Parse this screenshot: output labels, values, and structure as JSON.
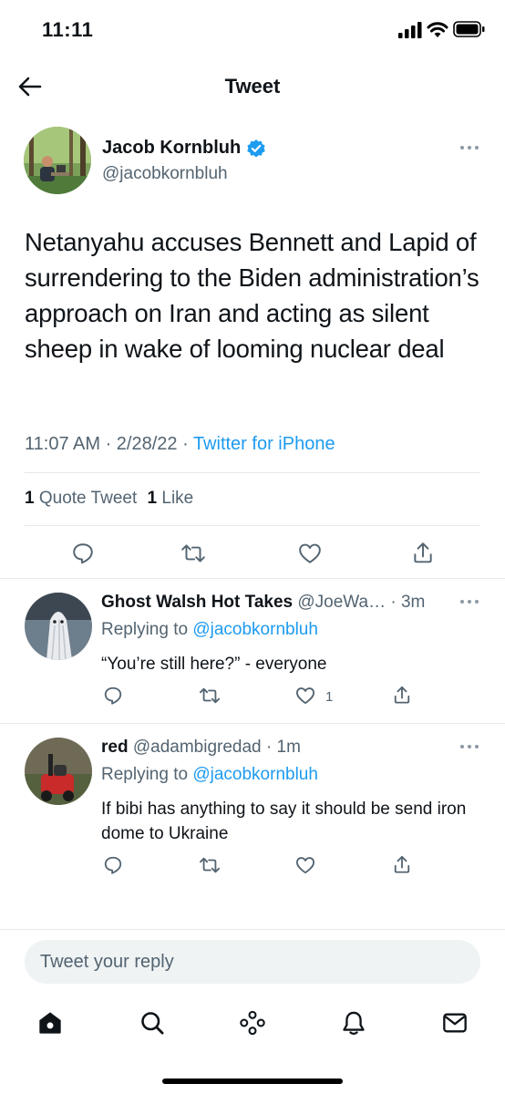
{
  "status_bar": {
    "time": "11:11"
  },
  "header": {
    "title": "Tweet"
  },
  "tweet": {
    "author_name": "Jacob Kornbluh",
    "author_handle": "@jacobkornbluh",
    "text": "Netanyahu accuses Bennett and Lapid of surrendering to the Biden administration’s approach on Iran and acting as silent sheep in wake of looming nuclear deal",
    "timestamp": "11:07 AM · 2/28/22 · ",
    "source": "Twitter for iPhone",
    "quote_count": "1",
    "quote_label": "Quote Tweet",
    "like_count": "1",
    "like_label": "Like"
  },
  "replies": [
    {
      "name": "Ghost Walsh Hot Takes",
      "handle_time": "@JoeWa… · 3m",
      "replying_label": "Replying to ",
      "replying_to": "@jacobkornbluh",
      "text": "“You’re still here?” - everyone",
      "like_count": "1"
    },
    {
      "name": "red",
      "handle_time": "@adambigredad · 1m",
      "replying_label": "Replying to ",
      "replying_to": "@jacobkornbluh",
      "text": "If bibi has anything to say it should be send iron dome to Ukraine",
      "like_count": ""
    }
  ],
  "reply_box": {
    "placeholder": "Tweet your reply"
  },
  "colors": {
    "accent": "#1d9bf0",
    "text": "#0f1419",
    "secondary": "#536471",
    "border": "#e6e9ec"
  },
  "icons": [
    "back-arrow-icon",
    "verified-badge-icon",
    "more-icon",
    "reply-icon",
    "retweet-icon",
    "like-icon",
    "share-icon",
    "home-icon",
    "search-icon",
    "spaces-icon",
    "notifications-icon",
    "messages-icon"
  ]
}
